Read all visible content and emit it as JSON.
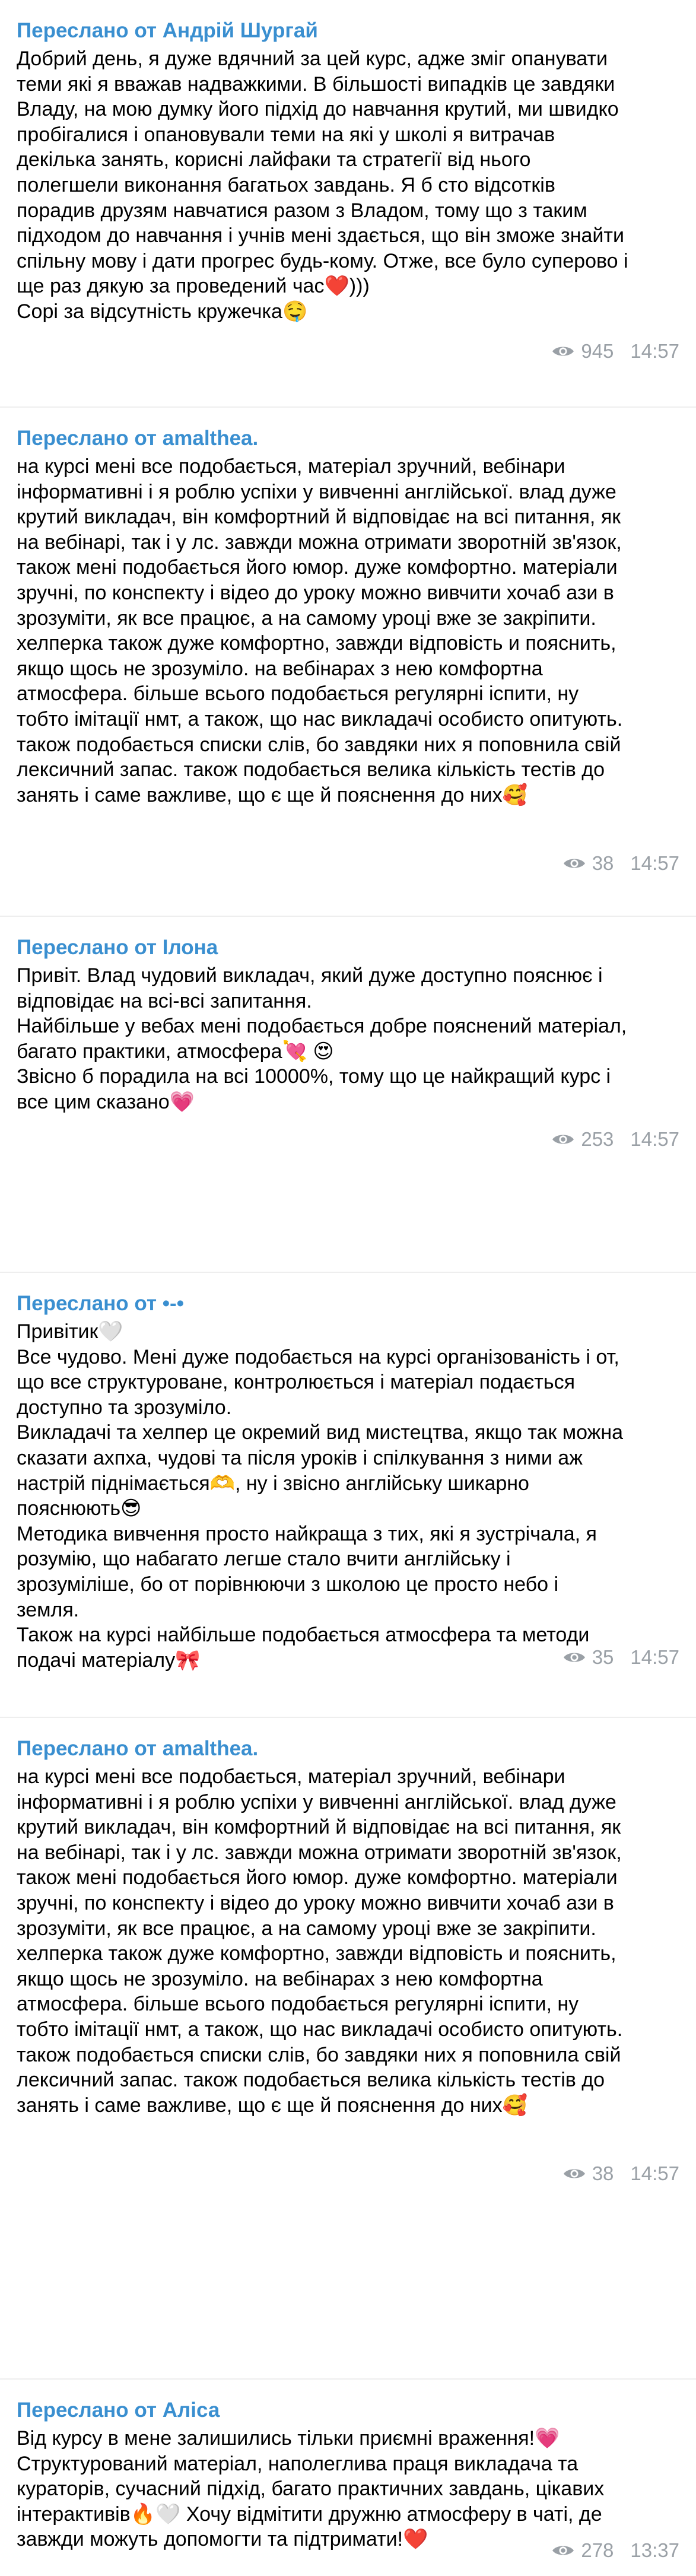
{
  "messages": [
    {
      "sender": "Переслано от Андрій Шургай",
      "text": "Добрий день, я дуже вдячний за цей курс, адже зміг опанувати\nтеми які я вважав надважкими. В більшості випадків це завдяки\nВладу, на мою думку його підхід до навчання крутий, ми швидко\nпробігалися і опановували теми на які у школі я витрачав\nдекілька занять, корисні лайфаки та стратегії від нього\nполегшели виконання багатьох завдань. Я б сто відсотків\nпорадив друзям навчатися разом з Владом, тому що з таким\nпідходом до навчання і учнів мені здається, що він зможе знайти\nспільну мову і дати прогрес будь-кому. Отже, все було суперово і\nще раз дякую за проведений час❤️)))\nСорі за відсутність кружечка🤤",
      "views": "945",
      "time": "14:57"
    },
    {
      "sender": "Переслано от amalthea.",
      "text": "на курсі мені все подобається, матеріал зручний, вебінари\nінформативні і я роблю успіхи у вивченні англійської. влад дуже\nкрутий викладач, він комфортний й відповідає на всі питання, як\nна вебінарі, так і у лс. завжди можна отримати зворотній зв'язок,\nтакож мені подобається його юмор. дуже комфортно. матеріали\nзручні, по конспекту і відео до уроку можно вивчити хочаб ази в\nзрозуміти, як все працює, а на самому уроці вже зе закріпити.\nхелперка також дуже комфортно, завжди відповість и пояснить,\nякщо щось не зрозуміло. на вебінарах з нею комфортна\nатмосфера. більше всього подобається регулярні іспити, ну\nтобто імітації нмт, а також, що нас викладачі особисто опитують.\nтакож подобається списки слів, бо завдяки них я поповнила свій\nлексичний запас. також подобається велика кількість тестів до\nзанять і саме важливе, що є ще й пояснення до них🥰",
      "views": "38",
      "time": "14:57"
    },
    {
      "sender": "Переслано от Ілона",
      "text": "Привіт. Влад чудовий викладач, який дуже доступно пояснює і\nвідповідає на всі-всі запитання.\nНайбільше у вебах мені подобається добре пояснений матеріал,\nбагато практики, атмосфера💘 😍\nЗвісно б порадила на всі 10000%, тому що це найкращий курс і\nвсе цим сказано💗",
      "views": "253",
      "time": "14:57"
    },
    {
      "sender": "Переслано от •-•",
      "text": "Привітик🤍\nВсе чудово. Мені дуже подобається на курсі організованість і от,\nщо все структуроване, контролюється і матеріал подається\nдоступно та зрозуміло.\nВикладачі та хелпер це окремий вид мистецтва, якщо так можна\nсказати ахпха, чудові та після уроків і спілкування з ними аж\nнастрій піднімається🫶, ну і звісно англійську шикарно\nпояснюють😎\nМетодика вивчення просто найкраща з тих, які я зустрічала, я\nрозумію, що набагато легше стало вчити англійську і\nзрозуміліше, бо от порівнюючи з школою це просто небо і\nземля.\nТакож на курсі найбільше подобається атмосфера та методи\nподачі матеріалу🎀",
      "views": "35",
      "time": "14:57"
    },
    {
      "sender": "Переслано от amalthea.",
      "text": "на курсі мені все подобається, матеріал зручний, вебінари\nінформативні і я роблю успіхи у вивченні англійської. влад дуже\nкрутий викладач, він комфортний й відповідає на всі питання, як\nна вебінарі, так і у лс. завжди можна отримати зворотній зв'язок,\nтакож мені подобається його юмор. дуже комфортно. матеріали\nзручні, по конспекту і відео до уроку можно вивчити хочаб ази в\nзрозуміти, як все працює, а на самому уроці вже зе закріпити.\nхелперка також дуже комфортно, завжди відповість и пояснить,\nякщо щось не зрозуміло. на вебінарах з нею комфортна\nатмосфера. більше всього подобається регулярні іспити, ну\nтобто імітації нмт, а також, що нас викладачі особисто опитують.\nтакож подобається списки слів, бо завдяки них я поповнила свій\nлексичний запас. також подобається велика кількість тестів до\nзанять і саме важливе, що є ще й пояснення до них🥰",
      "views": "38",
      "time": "14:57"
    },
    {
      "sender": "Переслано от Аліса",
      "text": "Від курсу в мене залишились тільки приємні враження!💗\nСтруктурований матеріал, наполеглива праця викладача та\nкураторів, сучасний підхід, багато практичних завдань, цікавих\nінтерактивів🔥🤍 Хочу відмітити дружню атмосферу в чаті, де\nзавжди можуть допомогти та підтримати!❤️",
      "views": "278",
      "time": "13:37"
    }
  ],
  "icons": {
    "views": "eye-icon"
  },
  "colors": {
    "sender": "#3a8fd0",
    "meta": "#9aa0a6",
    "separator": "#eeeeee"
  }
}
